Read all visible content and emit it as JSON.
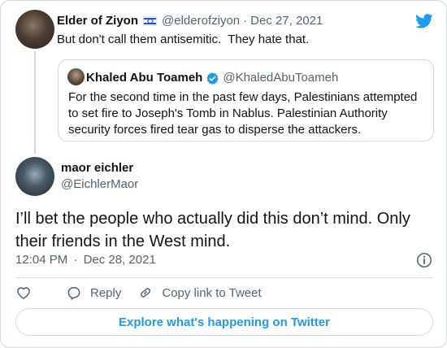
{
  "brand": {
    "accent": "#1d9bf0",
    "logo_icon": "twitter-bird-icon"
  },
  "tweet_parent": {
    "display_name": "Elder of Ziyon",
    "flag_icon": "israel-flag-icon",
    "handle": "@elderofziyon",
    "separator": "·",
    "date": "Dec 27, 2021",
    "text": "But don't call them antisemitic.  They hate that.",
    "quoted": {
      "display_name": "Khaled Abu Toameh",
      "verified_icon": "verified-badge-icon",
      "handle": "@KhaledAbuToameh",
      "text": "For the second time in the past few days, Palestinians attempted to set fire to Joseph's Tomb in Nablus. Palestinian Authority security forces fired tear gas to disperse the attackers."
    }
  },
  "tweet_main": {
    "display_name": "maor eichler",
    "handle": "@EichlerMaor",
    "text": "I’ll bet the people who actually did this don’t mind. Only their friends in the West mind.",
    "time": "12:04 PM",
    "separator": "·",
    "date": "Dec 28, 2021"
  },
  "actions": {
    "like_icon": "heart-icon",
    "reply_icon": "reply-bubble-icon",
    "reply_label": "Reply",
    "copy_icon": "link-icon",
    "copy_label": "Copy link to Tweet",
    "info_icon": "info-icon"
  },
  "explore": {
    "label": "Explore what's happening on Twitter"
  }
}
